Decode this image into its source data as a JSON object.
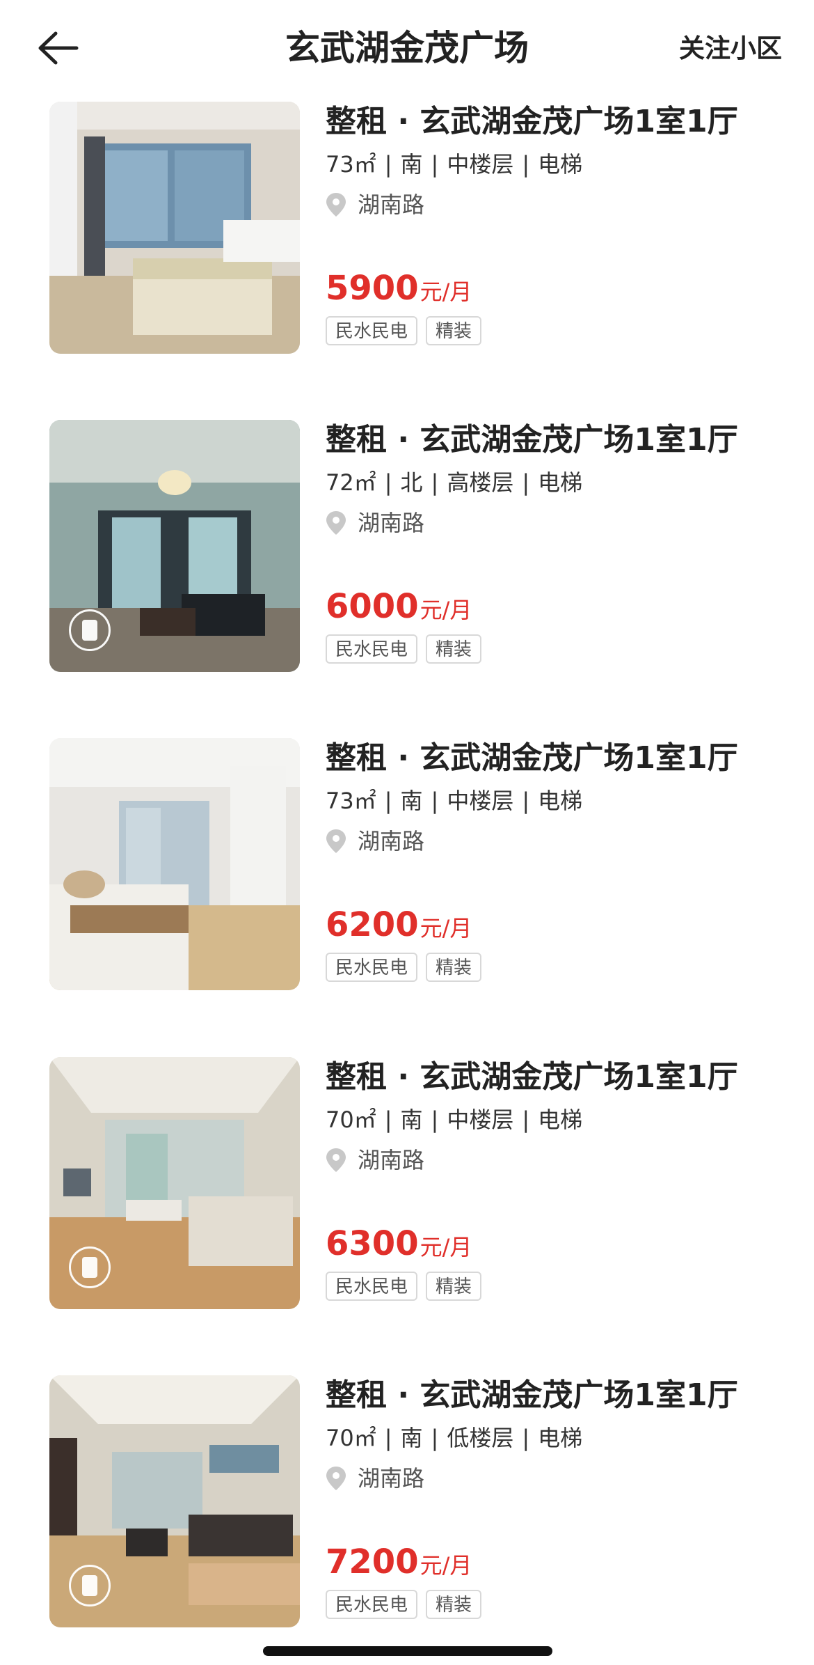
{
  "header": {
    "title": "玄武湖金茂广场",
    "follow_label": "关注小区"
  },
  "listings": [
    {
      "title": "整租 · 玄武湖金茂广场1室1厅",
      "area": "73㎡",
      "orientation": "南",
      "floor": "中楼层",
      "elevator": "电梯",
      "location": "湖南路",
      "price": "5900",
      "price_unit": "元/月",
      "tags": [
        "民水民电",
        "精装"
      ],
      "vr": false
    },
    {
      "title": "整租 · 玄武湖金茂广场1室1厅",
      "area": "72㎡",
      "orientation": "北",
      "floor": "高楼层",
      "elevator": "电梯",
      "location": "湖南路",
      "price": "6000",
      "price_unit": "元/月",
      "tags": [
        "民水民电",
        "精装"
      ],
      "vr": true
    },
    {
      "title": "整租 · 玄武湖金茂广场1室1厅",
      "area": "73㎡",
      "orientation": "南",
      "floor": "中楼层",
      "elevator": "电梯",
      "location": "湖南路",
      "price": "6200",
      "price_unit": "元/月",
      "tags": [
        "民水民电",
        "精装"
      ],
      "vr": false
    },
    {
      "title": "整租 · 玄武湖金茂广场1室1厅",
      "area": "70㎡",
      "orientation": "南",
      "floor": "中楼层",
      "elevator": "电梯",
      "location": "湖南路",
      "price": "6300",
      "price_unit": "元/月",
      "tags": [
        "民水民电",
        "精装"
      ],
      "vr": true
    },
    {
      "title": "整租 · 玄武湖金茂广场1室1厅",
      "area": "70㎡",
      "orientation": "南",
      "floor": "低楼层",
      "elevator": "电梯",
      "location": "湖南路",
      "price": "7200",
      "price_unit": "元/月",
      "tags": [
        "民水民电",
        "精装"
      ],
      "vr": true
    }
  ],
  "colors": {
    "price": "#e02f2a",
    "text": "#222222",
    "tag_border": "#d8d8d8"
  },
  "icons": {
    "back": "arrow-left-icon",
    "location": "location-pin-icon",
    "vr": "vr-view-icon"
  }
}
